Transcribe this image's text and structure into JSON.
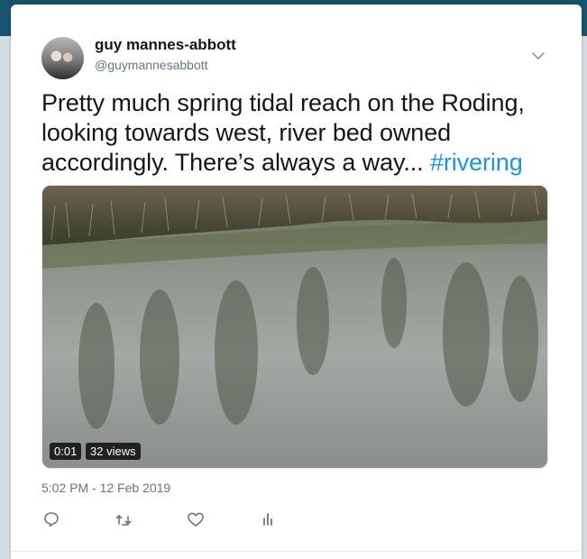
{
  "author": {
    "name": "guy mannes-abbott",
    "handle": "@guymannesabbott"
  },
  "tweet": {
    "text": "Pretty much spring tidal reach on the Roding, looking towards west, river bed owned accordingly. There’s always a way... ",
    "hashtag": "#rivering",
    "timestamp": "5:02 PM - 12 Feb 2019"
  },
  "video": {
    "duration": "0:01",
    "views": "32 views"
  },
  "actions": {
    "reply_icon": "reply-icon",
    "retweet_icon": "retweet-icon",
    "like_icon": "heart-icon",
    "analytics_icon": "analytics-icon"
  },
  "colors": {
    "header": "#17536e",
    "link": "#1b95e0",
    "secondary_text": "#657786"
  }
}
